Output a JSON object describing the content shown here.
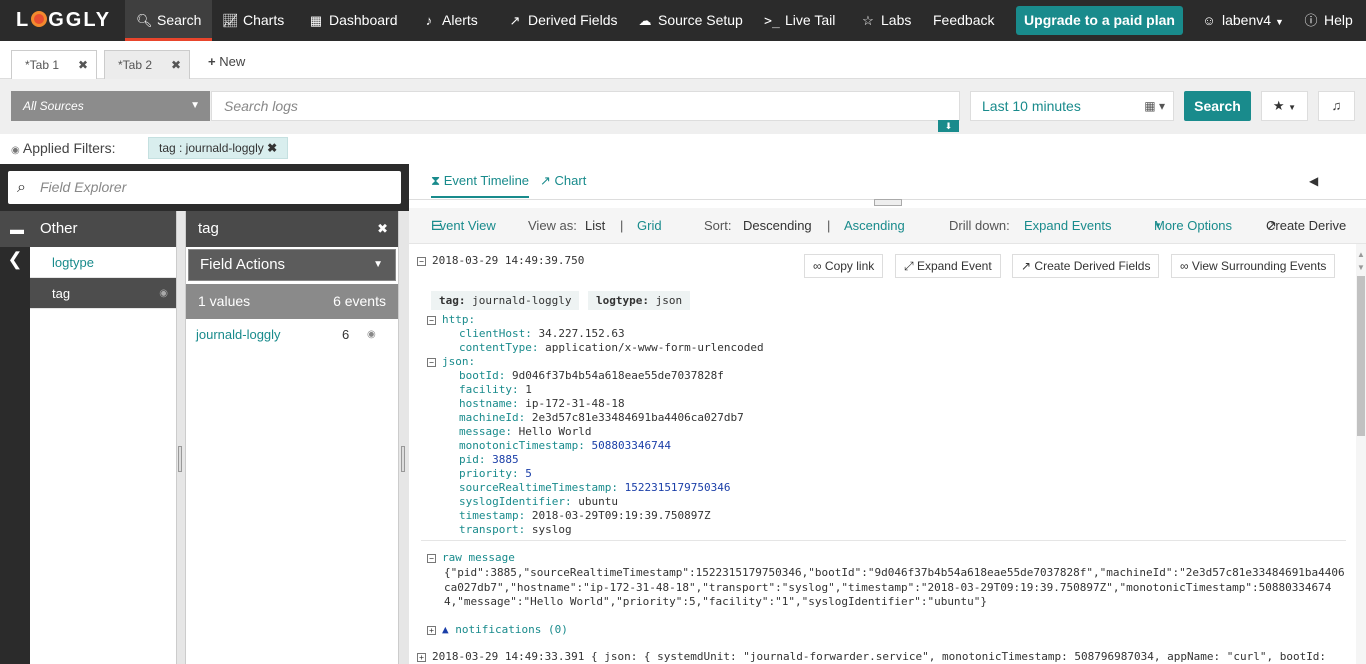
{
  "nav": {
    "logo": "LOGGLY",
    "items": [
      {
        "label": "Search",
        "icon": "search-icon"
      },
      {
        "label": "Charts",
        "icon": "chart-icon"
      },
      {
        "label": "Dashboard",
        "icon": "dashboard-icon"
      },
      {
        "label": "Alerts",
        "icon": "alerts-icon"
      },
      {
        "label": "Derived Fields",
        "icon": "derived-fields-icon"
      },
      {
        "label": "Source Setup",
        "icon": "cloud-icon"
      },
      {
        "label": "Live Tail",
        "icon": "terminal-icon"
      },
      {
        "label": "Labs",
        "icon": "lightbulb-icon"
      },
      {
        "label": "Feedback"
      }
    ],
    "upgrade": "Upgrade to a paid plan",
    "user": "labenv4",
    "help": "Help",
    "accent": "#e8452c",
    "teal": "#198b8c"
  },
  "tabs": {
    "tab1": "*Tab 1",
    "tab2": "*Tab 2",
    "new": "New"
  },
  "search": {
    "sources": "All Sources",
    "placeholder": "Search logs",
    "time_range": "Last 10 minutes",
    "button": "Search"
  },
  "filters": {
    "label": "Applied Filters:",
    "chip": "tag : journald-loggly"
  },
  "field_explorer": {
    "placeholder": "Field Explorer",
    "group": "Other",
    "items": [
      "logtype",
      "tag"
    ],
    "selected_field": "tag",
    "field_actions": "Field Actions",
    "values_count": "1 values",
    "events_count": "6 events",
    "value": "journald-loggly",
    "value_count": "6"
  },
  "view": {
    "tab_timeline": "Event Timeline",
    "tab_chart": "Chart",
    "event_view": "Event View",
    "view_as": "View as:",
    "list": "List",
    "grid": "Grid",
    "sort": "Sort:",
    "descending": "Descending",
    "ascending": "Ascending",
    "drill_down": "Drill down:",
    "expand_events": "Expand Events",
    "more_options": "More Options",
    "create_derived": "Create Derive"
  },
  "event": {
    "timestamp": "2018-03-29 14:49:39.750",
    "buttons": {
      "copy_link": "Copy link",
      "expand_event": "Expand Event",
      "create_derived_fields": "Create Derived Fields",
      "view_surrounding": "View Surrounding Events"
    },
    "tags": [
      {
        "key": "tag:",
        "value": "journald-loggly"
      },
      {
        "key": "logtype:",
        "value": "json"
      }
    ],
    "http_label": "http:",
    "http": [
      {
        "key": "clientHost:",
        "value": "34.227.152.63"
      },
      {
        "key": "contentType:",
        "value": "application/x-www-form-urlencoded"
      }
    ],
    "json_label": "json:",
    "json": [
      {
        "key": "bootId:",
        "value": "9d046f37b4b54a618eae55de7037828f"
      },
      {
        "key": "facility:",
        "value": "1"
      },
      {
        "key": "hostname:",
        "value": "ip-172-31-48-18"
      },
      {
        "key": "machineId:",
        "value": "2e3d57c81e33484691ba4406ca027db7"
      },
      {
        "key": "message:",
        "value": "Hello World"
      },
      {
        "key": "monotonicTimestamp:",
        "value": "508803346744"
      },
      {
        "key": "pid:",
        "value": "3885"
      },
      {
        "key": "priority:",
        "value": "5"
      },
      {
        "key": "sourceRealtimeTimestamp:",
        "value": "1522315179750346"
      },
      {
        "key": "syslogIdentifier:",
        "value": "ubuntu"
      },
      {
        "key": "timestamp:",
        "value": "2018-03-29T09:19:39.750897Z"
      },
      {
        "key": "transport:",
        "value": "syslog"
      }
    ],
    "raw_label": "raw message",
    "raw": "{\"pid\":3885,\"sourceRealtimeTimestamp\":1522315179750346,\"bootId\":\"9d046f37b4b54a618eae55de7037828f\",\"machineId\":\"2e3d57c81e33484691ba4406ca027db7\",\"hostname\":\"ip-172-31-48-18\",\"transport\":\"syslog\",\"timestamp\":\"2018-03-29T09:19:39.750897Z\",\"monotonicTimestamp\":508803346744,\"message\":\"Hello World\",\"priority\":5,\"facility\":\"1\",\"syslogIdentifier\":\"ubuntu\"}",
    "notifications": "notifications (0)"
  },
  "event2": {
    "timestamp": "2018-03-29 14:49:33.391",
    "preview": "{ json: { systemdUnit: \"journald-forwarder.service\", monotonicTimestamp: 508796987034, appName: \"curl\", bootId:"
  }
}
